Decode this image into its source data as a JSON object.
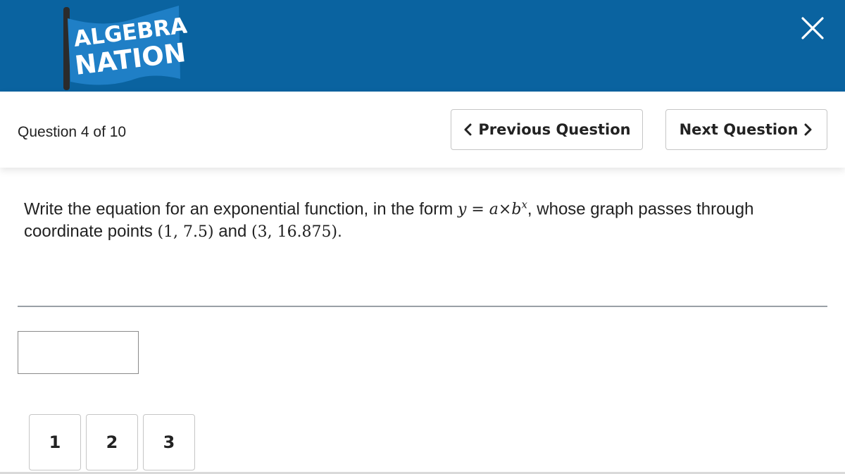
{
  "header": {
    "logo": {
      "line1": "ALGEBRA",
      "line2": "NATION"
    },
    "close_icon": "close-icon",
    "background_color": "#0a63a0"
  },
  "nav": {
    "counter": "Question 4 of 10",
    "previous_label": "Previous Question",
    "next_label": "Next Question"
  },
  "question": {
    "text_before": "Write the equation for an exponential function, in the form ",
    "formula_y": "y",
    "formula_eq": " = ",
    "formula_a": "a",
    "formula_times": "×",
    "formula_b": "b",
    "formula_x": "x",
    "text_middle": ", whose graph passes through coordinate points ",
    "point1": "(1, 7.5)",
    "text_and": " and ",
    "point2": "(3, 16.875)",
    "text_end": "."
  },
  "answer": {
    "value": "",
    "placeholder": ""
  },
  "pages": [
    "1",
    "2",
    "3"
  ]
}
